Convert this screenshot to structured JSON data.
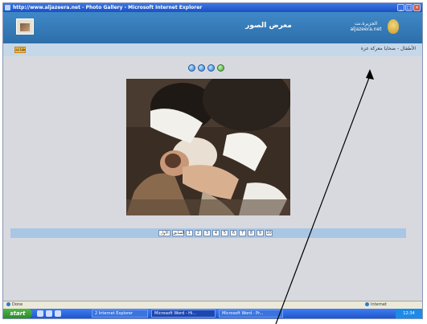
{
  "window": {
    "title": "http://www.aljazeera.net - Photo Gallery - Microsoft Internet Explorer",
    "title_buttons": [
      "_",
      "□",
      "×"
    ]
  },
  "header": {
    "gallery_title": "معرض الصور",
    "logo_text_line1": "الجزيرة.نت",
    "logo_text_line2": "aljazeera.net",
    "logo_icon": "aljazeera-logo-icon",
    "thumb_icon": "photo-gallery-icon"
  },
  "subbar": {
    "print_label": "طباعة",
    "breadcrumb": "الأطفال - ضحايا معركة غزة"
  },
  "nav": {
    "buttons": [
      "prev",
      "play",
      "pause",
      "next"
    ]
  },
  "pager": {
    "first_label": "الأول",
    "prev_label": "السابق",
    "pages": [
      "1",
      "2",
      "3",
      "4",
      "5",
      "6",
      "7",
      "8",
      "9",
      "10"
    ]
  },
  "statusbar": {
    "left": "Done",
    "right": "Internet"
  },
  "taskbar": {
    "start_label": "start",
    "items": [
      "2 Internet Explorer",
      "Microsoft Word - Hi...",
      "Microsoft Word - Pr..."
    ],
    "clock": "12:34"
  },
  "colors": {
    "header_blue": "#3f88c7",
    "subbar": "#c5d8ea",
    "page_bg": "#d8d9de",
    "pager_bar": "#a9c6e4"
  }
}
